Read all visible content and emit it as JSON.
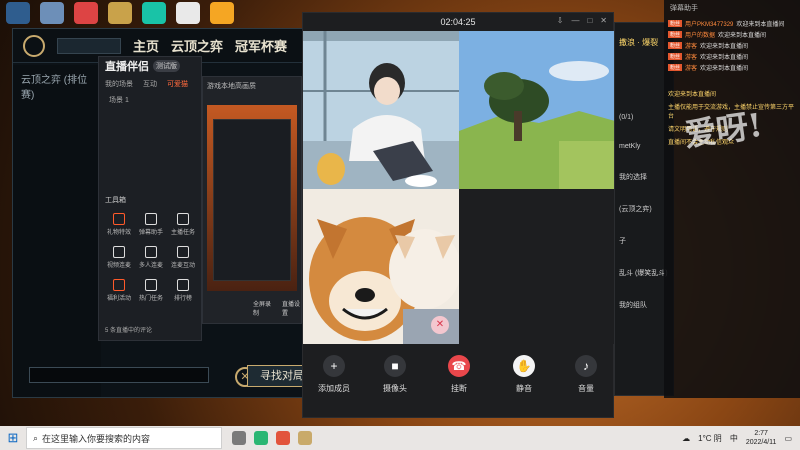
{
  "desktop_icons": [
    "app-icon-1",
    "app-icon-2",
    "app-icon-3",
    "app-icon-4",
    "app-icon-5",
    "app-icon-6",
    "app-icon-7",
    "app-icon-8"
  ],
  "lol": {
    "nav": [
      "主页",
      "云顶之弈",
      "冠军杯赛"
    ],
    "side_title": "云顶之弈 (排位赛)",
    "find_button": "寻找对局"
  },
  "helper": {
    "title": "直播伴侣",
    "version": "测试版",
    "tabs": [
      "我的场景",
      "互动",
      "可爱猫"
    ],
    "scene": "场景 1",
    "toolbox": "工具箱",
    "tools": [
      {
        "label": "礼物特效",
        "red": true
      },
      {
        "label": "弹幕助手",
        "red": false
      },
      {
        "label": "主播任务",
        "red": false
      },
      {
        "label": "视频连麦",
        "red": false
      },
      {
        "label": "多人连麦",
        "red": false
      },
      {
        "label": "连麦互动",
        "red": false
      },
      {
        "label": "福利活动",
        "red": true
      },
      {
        "label": "热门任务",
        "red": false
      },
      {
        "label": "排行榜",
        "red": false
      }
    ],
    "footer": "5 条直播中的评论"
  },
  "preview": {
    "tab": "游戏本地高画质",
    "buttons": [
      "全屏录制",
      "直播设置"
    ]
  },
  "call": {
    "time": "02:04:25",
    "controls": [
      {
        "icon": "+",
        "label": "添加成员",
        "style": ""
      },
      {
        "icon": "■",
        "label": "摄像头",
        "style": ""
      },
      {
        "icon": "☎",
        "label": "挂断",
        "style": "red"
      },
      {
        "icon": "✋",
        "label": "静音",
        "style": "white"
      },
      {
        "icon": "♪",
        "label": "音量",
        "style": ""
      }
    ]
  },
  "chat": {
    "title": "撒浪 · 爆裂",
    "lines": [
      "(0/1)",
      "metKly",
      "我的选择",
      "(云顶之弈)",
      "子",
      "乱斗 (爆笑乱斗)",
      "我的组队"
    ]
  },
  "right_panel": {
    "header": "弹幕助手",
    "rows": [
      {
        "badge": "粉丝",
        "name": "用户PKM3477329",
        "msg": "欢迎来到本直播间"
      },
      {
        "badge": "粉丝",
        "name": "用户的数据",
        "msg": "欢迎来到本直播间"
      },
      {
        "badge": "粉丝",
        "name": "游客",
        "msg": "欢迎来到本直播间"
      },
      {
        "badge": "粉丝",
        "name": "游客",
        "msg": "欢迎来到本直播间"
      },
      {
        "badge": "粉丝",
        "name": "游客",
        "msg": "欢迎来到本直播间"
      }
    ],
    "notes": [
      "欢迎来到本直播间",
      "主播仅能用于交流游戏，主播禁止宣传第三方平台",
      "请文明用语，遵守规则",
      "直播间不会主动私信观众"
    ],
    "overlay": "爱呀!"
  },
  "taskbar": {
    "search_placeholder": "在这里输入你要搜索的内容",
    "weather": "1°C 阴",
    "input_method": "中",
    "time": "2:77",
    "date": "2022/4/11"
  }
}
